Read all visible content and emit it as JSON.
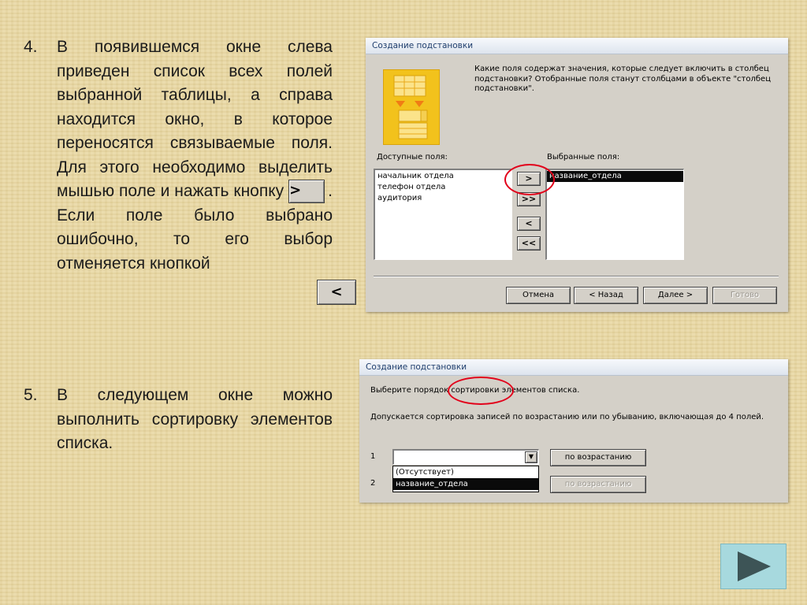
{
  "slide": {
    "item4": {
      "number": "4.",
      "text_part1": "В появившемся окне слева приведен список всех полей выбранной таблицы, а справа находится окно, в которое переносятся связываемые поля. Для этого необходимо выделить мышью поле и нажать кнопку",
      "inline_button_next": ">",
      "text_part2": ". Если поле было выбрано ошибочно, то его выбор отменяется кнопкой",
      "inline_button_back": "<"
    },
    "item5": {
      "number": "5.",
      "text": "В следующем окне можно выполнить сортировку элементов списка."
    }
  },
  "dialog1": {
    "title": "Создание подстановки",
    "description": "Какие поля содержат значения, которые следует включить в столбец подстановки? Отобранные поля станут столбцами в объекте \"столбец подстановки\".",
    "available_label": "Доступные поля:",
    "selected_label": "Выбранные поля:",
    "available_fields": [
      "начальник отдела",
      "телефон отдела",
      "аудитория"
    ],
    "selected_fields": [
      "название_отдела"
    ],
    "move_buttons": {
      "add": ">",
      "add_all": ">>",
      "remove": "<",
      "remove_all": "<<"
    },
    "footer_buttons": {
      "cancel": "Отмена",
      "back": "< Назад",
      "next": "Далее >",
      "finish": "Готово"
    }
  },
  "dialog2": {
    "title": "Создание подстановки",
    "instruction": "Выберите порядок сортировки элементов списка.",
    "note": "Допускается сортировка записей по возрастанию или по убыванию, включающая до 4 полей.",
    "rows": [
      {
        "number": "1",
        "value": "",
        "order_button": "по возрастанию"
      },
      {
        "number": "2",
        "value": "",
        "order_button": "по возрастанию"
      }
    ],
    "dropdown_options": [
      "(Отсутствует)",
      "название_отдела"
    ]
  },
  "colors": {
    "background": "#e9d9a6",
    "highlight_ring": "#e2001a",
    "dialog_face": "#d4d0c8",
    "title_text": "#1e3d6c",
    "next_slide_button": "#a7d9de"
  },
  "icons": {
    "wizard": "table-lookup-wizard-icon",
    "dropdown": "chevron-down-icon",
    "next_slide": "play-triangle-icon"
  }
}
